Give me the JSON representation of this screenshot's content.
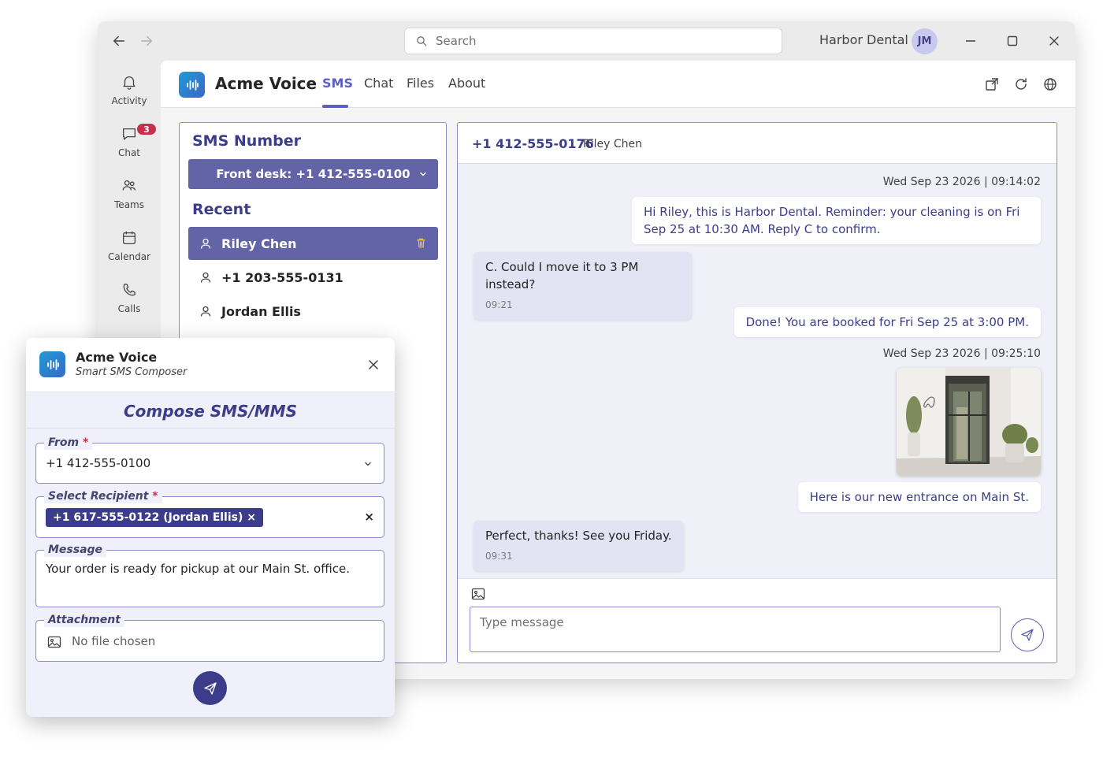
{
  "titlebar": {
    "search_placeholder": "Search",
    "org_name": "Harbor Dental",
    "avatar_initials": "JM"
  },
  "rail": {
    "items": [
      {
        "label": "Activity",
        "icon": "bell-icon"
      },
      {
        "label": "Chat",
        "icon": "chat-icon",
        "badge": "3"
      },
      {
        "label": "Teams",
        "icon": "teams-icon"
      },
      {
        "label": "Calendar",
        "icon": "calendar-icon"
      },
      {
        "label": "Calls",
        "icon": "phone-icon"
      }
    ]
  },
  "app": {
    "title": "Acme Voice",
    "tabs": [
      {
        "label": "SMS",
        "active": true
      },
      {
        "label": "Chat",
        "active": false
      },
      {
        "label": "Files",
        "active": false
      },
      {
        "label": "About",
        "active": false
      }
    ]
  },
  "sms_panel": {
    "heading": "SMS Number",
    "selected_number": "Front desk: +1 412-555-0100",
    "recent_heading": "Recent",
    "recent": [
      {
        "label": "Riley Chen",
        "selected": true
      },
      {
        "label": "+1 203-555-0131",
        "selected": false
      },
      {
        "label": "Jordan Ellis",
        "selected": false
      }
    ]
  },
  "conversation": {
    "number": "+1 412-555-0176",
    "name": "Riley Chen",
    "timestamp_1": "Wed Sep 23 2026 | 09:14:02",
    "messages": [
      {
        "direction": "out",
        "text": "Hi Riley, this is Harbor Dental. Reminder: your cleaning is on Fri Sep 25 at 10:30 AM. Reply C to confirm."
      },
      {
        "direction": "in",
        "text": "C. Could I move it to 3 PM instead?",
        "time": "09:21"
      },
      {
        "direction": "out",
        "text": "Done! You are booked for Fri Sep 25 at 3:00 PM."
      },
      {
        "direction": "out",
        "text": "Here is our new entrance on Main St."
      },
      {
        "direction": "in",
        "text": "Perfect, thanks! See you Friday.",
        "time": "09:31"
      }
    ],
    "timestamp_2": "Wed Sep 23 2026 | 09:25:10",
    "input_placeholder": "Type message"
  },
  "popup": {
    "title": "Acme Voice",
    "subtitle": "Smart SMS Composer",
    "heading": "Compose SMS/MMS",
    "from_label": "From",
    "from_value": "+1 412-555-0100",
    "recipient_label": "Select Recipient",
    "recipient_chip": "+1 617-555-0122 (Jordan Ellis) ×",
    "clear": "×",
    "message_label": "Message",
    "message_value": "Your order is ready for pickup at our Main St. office.",
    "attachment_label": "Attachment",
    "attachment_value": "No file chosen",
    "required_mark": "*"
  },
  "colors": {
    "accent": "#5b5fc7",
    "panel_blue": "#6264a7",
    "dark_indigo": "#3b3d8a",
    "badge_red": "#c4314b"
  }
}
